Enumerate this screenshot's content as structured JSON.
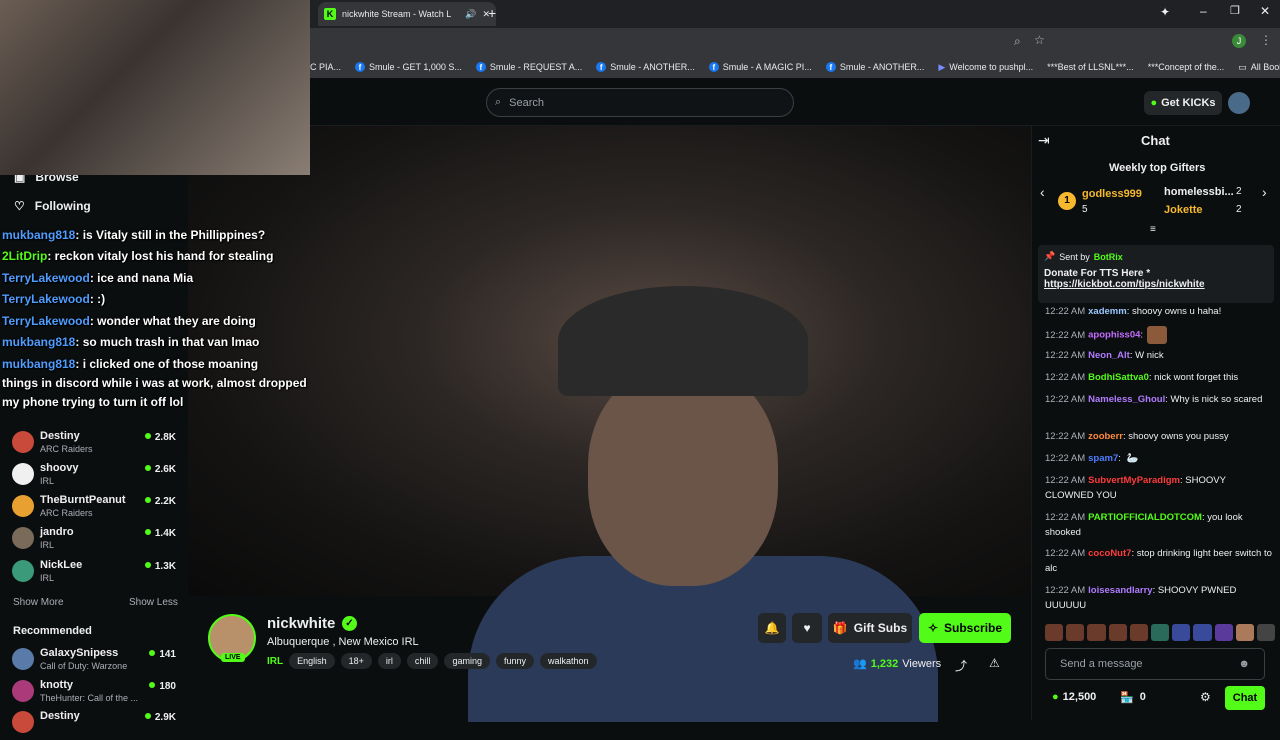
{
  "browser": {
    "tab_title": "nickwhite Stream - Watch L",
    "bookmarks": [
      "C PIA...",
      "Smule - GET 1,000 S...",
      "Smule - REQUEST A...",
      "Smule - ANOTHER...",
      "Smule - A MAGIC PI...",
      "Smule - ANOTHER...",
      "Welcome to pushpl...",
      "***Best of LLSNL***...",
      "***Concept of the..."
    ],
    "all_bookmarks": "All Bookmarks"
  },
  "header": {
    "search_placeholder": "Search",
    "get_kicks": "Get KICKs"
  },
  "sidebar": {
    "browse": "Browse",
    "following": "Following",
    "channels": [
      {
        "name": "Destiny",
        "category": "ARC Raiders",
        "viewers": "2.8K"
      },
      {
        "name": "shoovy",
        "category": "IRL",
        "viewers": "2.6K"
      },
      {
        "name": "TheBurntPeanut",
        "category": "ARC Raiders",
        "viewers": "2.2K"
      },
      {
        "name": "jandro",
        "category": "IRL",
        "viewers": "1.4K"
      },
      {
        "name": "NickLee",
        "category": "IRL",
        "viewers": "1.3K"
      }
    ],
    "show_more": "Show More",
    "show_less": "Show Less",
    "recommended": "Recommended",
    "recommended_channels": [
      {
        "name": "GalaxySnipess",
        "category": "Call of Duty: Warzone",
        "viewers": "141"
      },
      {
        "name": "knotty",
        "category": "TheHunter: Call of the ...",
        "viewers": "180"
      },
      {
        "name": "Destiny",
        "category": "",
        "viewers": "2.9K"
      }
    ]
  },
  "overlay_chat": [
    {
      "user": "mukbang818",
      "text": ": is Vitaly still in the Phillippines?"
    },
    {
      "user": "2LitDrip",
      "text": ": reckon vitaly lost his hand for stealing"
    },
    {
      "user": "TerryLakewood",
      "text": ": ice and nana Mia"
    },
    {
      "user": "TerryLakewood",
      "text": ": :)"
    },
    {
      "user": "TerryLakewood",
      "text": ": wonder what they are doing"
    },
    {
      "user": "mukbang818",
      "text": ": so much trash in that van lmao"
    },
    {
      "user": "mukbang818",
      "text": ": i clicked one of those moaning"
    },
    {
      "user": "",
      "text": "things in discord while i was at work, almost dropped"
    },
    {
      "user": "",
      "text": "my phone trying to turn it off lol"
    }
  ],
  "stream": {
    "name": "nickwhite",
    "title": "Albuquerque , New Mexico IRL",
    "live": "LIVE",
    "category": "IRL",
    "tags": [
      "English",
      "18+",
      "irl",
      "chill",
      "gaming",
      "funny",
      "walkathon"
    ],
    "gift_subs": "Gift Subs",
    "subscribe": "Subscribe",
    "viewers": "1,232",
    "viewers_label": "Viewers"
  },
  "chat": {
    "title": "Chat",
    "weekly_title": "Weekly top Gifters",
    "gifters": [
      {
        "name": "godless999",
        "count": "5"
      },
      {
        "name": "homelessbi...",
        "count": "2"
      },
      {
        "name": "Jokette",
        "count": "2"
      }
    ],
    "pinned_sent_by": "Sent by",
    "pinned_user": "BotRix",
    "pinned_text": "Donate For TTS Here *",
    "pinned_link": "https://kickbot.com/tips/nickwhite",
    "messages": [
      {
        "time": "12:22 AM",
        "user": "xademm",
        "color": "#9ac7ff",
        "text": ": shoovy owns u haha!"
      },
      {
        "time": "12:22 AM",
        "user": "apophiss04",
        "color": "#c46bff",
        "text": ":"
      },
      {
        "time": "12:22 AM",
        "user": "Neon_Alt",
        "color": "#b07bff",
        "text": ": W nick"
      },
      {
        "time": "12:22 AM",
        "user": "BodhiSattva0",
        "color": "#53fc18",
        "text": ": nick wont forget this"
      },
      {
        "time": "12:22 AM",
        "user": "Nameless_Ghoul",
        "color": "#b07bff",
        "text": ": Why is nick so scared"
      },
      {
        "time": "12:22 AM",
        "user": "zooberr",
        "color": "#ff8a3d",
        "text": ": shoovy owns you pussy"
      },
      {
        "time": "12:22 AM",
        "user": "spam7",
        "color": "#4f7dff",
        "text": ":"
      },
      {
        "time": "12:22 AM",
        "user": "SubvertMyParadigm",
        "color": "#ff3b3b",
        "text": ": SHOOVY CLOWNED YOU"
      },
      {
        "time": "12:22 AM",
        "user": "PARTIOFFICIALDOTCOM",
        "color": "#53fc18",
        "text": ": you look shooked"
      },
      {
        "time": "12:22 AM",
        "user": "cocoNut7",
        "color": "#ff3b3b",
        "text": ": stop drinking light beer switch to alc"
      },
      {
        "time": "12:22 AM",
        "user": "loisesandlarry",
        "color": "#b07bff",
        "text": ": SHOOVY PWNED UUUUUU"
      }
    ],
    "input_placeholder": "Send a message",
    "balance": "12,500",
    "points": "0",
    "send_button": "Chat"
  }
}
